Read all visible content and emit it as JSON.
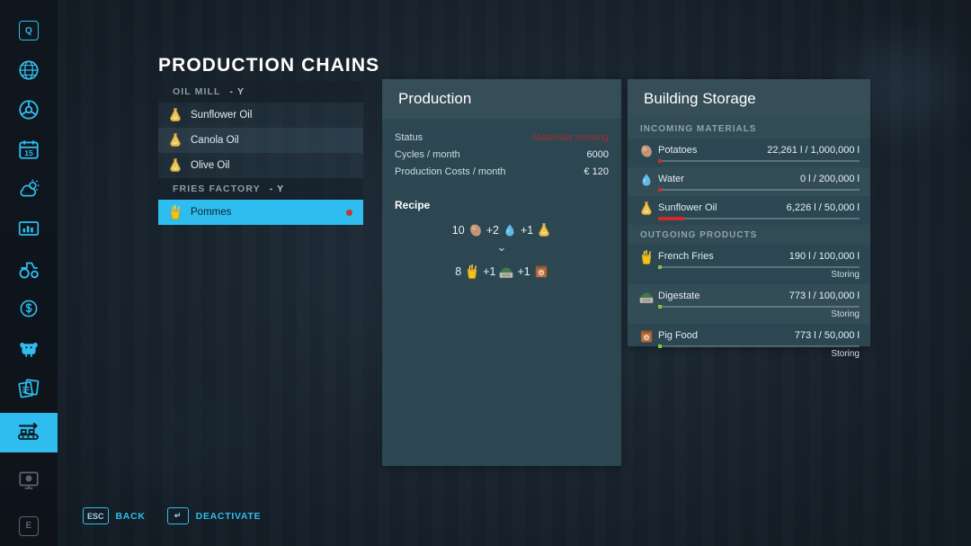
{
  "page": {
    "title": "PRODUCTION CHAINS"
  },
  "sidebar": {
    "items": [
      {
        "name": "help-key",
        "icon": "key-q",
        "label": "Q",
        "active": false,
        "dim": false
      },
      {
        "name": "globe",
        "icon": "globe-icon",
        "label": "",
        "active": false,
        "dim": false
      },
      {
        "name": "vehicles-wheel",
        "icon": "steering-wheel-icon",
        "label": "",
        "active": false,
        "dim": false
      },
      {
        "name": "calendar",
        "icon": "calendar-icon",
        "label": "15",
        "active": false,
        "dim": false
      },
      {
        "name": "weather",
        "icon": "weather-icon",
        "label": "",
        "active": false,
        "dim": false
      },
      {
        "name": "statistics",
        "icon": "chart-icon",
        "label": "",
        "active": false,
        "dim": false
      },
      {
        "name": "vehicle-tractor",
        "icon": "tractor-icon",
        "label": "",
        "active": false,
        "dim": false
      },
      {
        "name": "finances",
        "icon": "dollar-icon",
        "label": "",
        "active": false,
        "dim": false
      },
      {
        "name": "animals",
        "icon": "cow-icon",
        "label": "",
        "active": false,
        "dim": false
      },
      {
        "name": "contracts",
        "icon": "documents-icon",
        "label": "",
        "active": false,
        "dim": false
      },
      {
        "name": "production-chains",
        "icon": "conveyor-icon",
        "label": "",
        "active": true,
        "dim": false
      },
      {
        "name": "screenshot",
        "icon": "monitor-icon",
        "label": "",
        "active": false,
        "dim": true
      },
      {
        "name": "exit-key",
        "icon": "key-e",
        "label": "E",
        "active": false,
        "dim": true
      }
    ]
  },
  "chain_list": {
    "groups": [
      {
        "header": "OIL MILL",
        "hotkey": "-  Y",
        "items": [
          {
            "label": "Sunflower Oil",
            "icon": "oil-bottle-icon",
            "selected": false,
            "alt": false,
            "dot": ""
          },
          {
            "label": "Canola Oil",
            "icon": "oil-bottle-icon",
            "selected": false,
            "alt": true,
            "dot": ""
          },
          {
            "label": "Olive Oil",
            "icon": "oil-bottle-icon",
            "selected": false,
            "alt": false,
            "dot": ""
          }
        ]
      },
      {
        "header": "FRIES FACTORY",
        "hotkey": "-  Y",
        "items": [
          {
            "label": "Pommes",
            "icon": "fries-icon",
            "selected": true,
            "alt": false,
            "dot": "red"
          }
        ]
      }
    ]
  },
  "production": {
    "title": "Production",
    "rows": [
      {
        "label": "Status",
        "value": "Materials missing",
        "warn": true
      },
      {
        "label": "Cycles / month",
        "value": "6000",
        "warn": false
      },
      {
        "label": "Production Costs / month",
        "value": "€ 120",
        "warn": false
      }
    ],
    "recipe_title": "Recipe",
    "recipe": {
      "inputs": [
        {
          "qty": "10",
          "icon": "potato-icon"
        },
        {
          "qty": "+2",
          "icon": "water-drop-icon"
        },
        {
          "qty": "+1",
          "icon": "oil-bottle-icon"
        }
      ],
      "arrow": "⌄",
      "outputs": [
        {
          "qty": "8",
          "icon": "fries-icon"
        },
        {
          "qty": "+1",
          "icon": "digestate-icon"
        },
        {
          "qty": "+1",
          "icon": "pig-food-icon"
        }
      ]
    }
  },
  "storage": {
    "title": "Building Storage",
    "sections": [
      {
        "header": "INCOMING MATERIALS",
        "rows": [
          {
            "name": "Potatoes",
            "icon": "potato-icon",
            "amount": "22,261 l / 1,000,000 l",
            "fill": 2,
            "fill_color": "red",
            "status": "",
            "alt": false
          },
          {
            "name": "Water",
            "icon": "water-drop-icon",
            "amount": "0 l / 200,000 l",
            "fill": 2,
            "fill_color": "red",
            "status": "",
            "alt": true
          },
          {
            "name": "Sunflower Oil",
            "icon": "oil-bottle-icon",
            "amount": "6,226 l / 50,000 l",
            "fill": 13,
            "fill_color": "red",
            "status": "",
            "alt": false
          }
        ]
      },
      {
        "header": "OUTGOING PRODUCTS",
        "rows": [
          {
            "name": "French Fries",
            "icon": "fries-icon",
            "amount": "190 l / 100,000 l",
            "fill": 2,
            "fill_color": "green",
            "status": "Storing",
            "alt": false
          },
          {
            "name": "Digestate",
            "icon": "digestate-icon",
            "amount": "773 l / 100,000 l",
            "fill": 2,
            "fill_color": "green",
            "status": "Storing",
            "alt": true
          },
          {
            "name": "Pig Food",
            "icon": "pig-food-icon",
            "amount": "773 l / 50,000 l",
            "fill": 2,
            "fill_color": "green",
            "status": "Storing",
            "alt": false
          }
        ]
      }
    ]
  },
  "bottom_bar": {
    "hints": [
      {
        "key": "ESC",
        "text": "BACK"
      },
      {
        "key": "↵",
        "text": "DEACTIVATE"
      }
    ]
  },
  "colors": {
    "accent": "#2ebdee",
    "panel": "#2c4751",
    "warn": "#9c3030",
    "bar_red": "#cf2b2b",
    "bar_green": "#7ec83c"
  }
}
